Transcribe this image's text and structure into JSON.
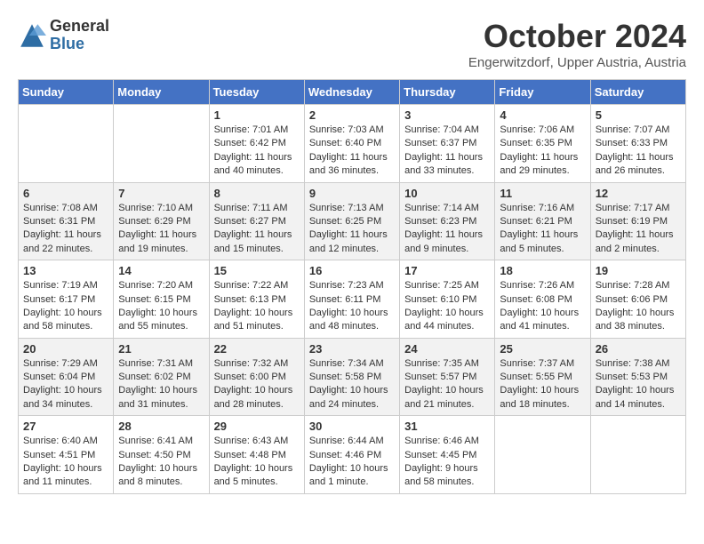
{
  "logo": {
    "general": "General",
    "blue": "Blue"
  },
  "header": {
    "month": "October 2024",
    "location": "Engerwitzdorf, Upper Austria, Austria"
  },
  "days_of_week": [
    "Sunday",
    "Monday",
    "Tuesday",
    "Wednesday",
    "Thursday",
    "Friday",
    "Saturday"
  ],
  "weeks": [
    [
      {
        "day": "",
        "content": ""
      },
      {
        "day": "",
        "content": ""
      },
      {
        "day": "1",
        "content": "Sunrise: 7:01 AM\nSunset: 6:42 PM\nDaylight: 11 hours and 40 minutes."
      },
      {
        "day": "2",
        "content": "Sunrise: 7:03 AM\nSunset: 6:40 PM\nDaylight: 11 hours and 36 minutes."
      },
      {
        "day": "3",
        "content": "Sunrise: 7:04 AM\nSunset: 6:37 PM\nDaylight: 11 hours and 33 minutes."
      },
      {
        "day": "4",
        "content": "Sunrise: 7:06 AM\nSunset: 6:35 PM\nDaylight: 11 hours and 29 minutes."
      },
      {
        "day": "5",
        "content": "Sunrise: 7:07 AM\nSunset: 6:33 PM\nDaylight: 11 hours and 26 minutes."
      }
    ],
    [
      {
        "day": "6",
        "content": "Sunrise: 7:08 AM\nSunset: 6:31 PM\nDaylight: 11 hours and 22 minutes."
      },
      {
        "day": "7",
        "content": "Sunrise: 7:10 AM\nSunset: 6:29 PM\nDaylight: 11 hours and 19 minutes."
      },
      {
        "day": "8",
        "content": "Sunrise: 7:11 AM\nSunset: 6:27 PM\nDaylight: 11 hours and 15 minutes."
      },
      {
        "day": "9",
        "content": "Sunrise: 7:13 AM\nSunset: 6:25 PM\nDaylight: 11 hours and 12 minutes."
      },
      {
        "day": "10",
        "content": "Sunrise: 7:14 AM\nSunset: 6:23 PM\nDaylight: 11 hours and 9 minutes."
      },
      {
        "day": "11",
        "content": "Sunrise: 7:16 AM\nSunset: 6:21 PM\nDaylight: 11 hours and 5 minutes."
      },
      {
        "day": "12",
        "content": "Sunrise: 7:17 AM\nSunset: 6:19 PM\nDaylight: 11 hours and 2 minutes."
      }
    ],
    [
      {
        "day": "13",
        "content": "Sunrise: 7:19 AM\nSunset: 6:17 PM\nDaylight: 10 hours and 58 minutes."
      },
      {
        "day": "14",
        "content": "Sunrise: 7:20 AM\nSunset: 6:15 PM\nDaylight: 10 hours and 55 minutes."
      },
      {
        "day": "15",
        "content": "Sunrise: 7:22 AM\nSunset: 6:13 PM\nDaylight: 10 hours and 51 minutes."
      },
      {
        "day": "16",
        "content": "Sunrise: 7:23 AM\nSunset: 6:11 PM\nDaylight: 10 hours and 48 minutes."
      },
      {
        "day": "17",
        "content": "Sunrise: 7:25 AM\nSunset: 6:10 PM\nDaylight: 10 hours and 44 minutes."
      },
      {
        "day": "18",
        "content": "Sunrise: 7:26 AM\nSunset: 6:08 PM\nDaylight: 10 hours and 41 minutes."
      },
      {
        "day": "19",
        "content": "Sunrise: 7:28 AM\nSunset: 6:06 PM\nDaylight: 10 hours and 38 minutes."
      }
    ],
    [
      {
        "day": "20",
        "content": "Sunrise: 7:29 AM\nSunset: 6:04 PM\nDaylight: 10 hours and 34 minutes."
      },
      {
        "day": "21",
        "content": "Sunrise: 7:31 AM\nSunset: 6:02 PM\nDaylight: 10 hours and 31 minutes."
      },
      {
        "day": "22",
        "content": "Sunrise: 7:32 AM\nSunset: 6:00 PM\nDaylight: 10 hours and 28 minutes."
      },
      {
        "day": "23",
        "content": "Sunrise: 7:34 AM\nSunset: 5:58 PM\nDaylight: 10 hours and 24 minutes."
      },
      {
        "day": "24",
        "content": "Sunrise: 7:35 AM\nSunset: 5:57 PM\nDaylight: 10 hours and 21 minutes."
      },
      {
        "day": "25",
        "content": "Sunrise: 7:37 AM\nSunset: 5:55 PM\nDaylight: 10 hours and 18 minutes."
      },
      {
        "day": "26",
        "content": "Sunrise: 7:38 AM\nSunset: 5:53 PM\nDaylight: 10 hours and 14 minutes."
      }
    ],
    [
      {
        "day": "27",
        "content": "Sunrise: 6:40 AM\nSunset: 4:51 PM\nDaylight: 10 hours and 11 minutes."
      },
      {
        "day": "28",
        "content": "Sunrise: 6:41 AM\nSunset: 4:50 PM\nDaylight: 10 hours and 8 minutes."
      },
      {
        "day": "29",
        "content": "Sunrise: 6:43 AM\nSunset: 4:48 PM\nDaylight: 10 hours and 5 minutes."
      },
      {
        "day": "30",
        "content": "Sunrise: 6:44 AM\nSunset: 4:46 PM\nDaylight: 10 hours and 1 minute."
      },
      {
        "day": "31",
        "content": "Sunrise: 6:46 AM\nSunset: 4:45 PM\nDaylight: 9 hours and 58 minutes."
      },
      {
        "day": "",
        "content": ""
      },
      {
        "day": "",
        "content": ""
      }
    ]
  ]
}
